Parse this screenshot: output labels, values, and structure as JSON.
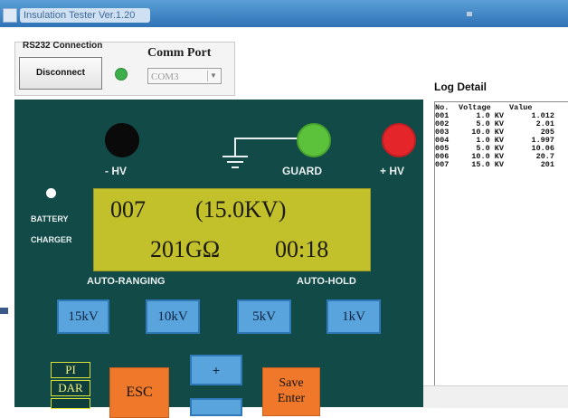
{
  "window": {
    "title": "Insulation Tester Ver.1.20"
  },
  "connection": {
    "group_label": "RS232 Connection",
    "disconnect_label": "Disconnect",
    "comm_port_label": "Comm Port",
    "comm_port_value": "COM3",
    "status_color": "#3cae4a"
  },
  "panel": {
    "hv_minus_label": "- HV",
    "guard_label": "GUARD",
    "hv_plus_label": "+ HV",
    "battery_label": "BATTERY",
    "charger_label": "CHARGER",
    "display": {
      "record_no": "007",
      "voltage": "(15.0KV)",
      "resistance": "201GΩ",
      "time": "00:18"
    },
    "auto_ranging_label": "AUTO-RANGING",
    "auto_hold_label": "AUTO-HOLD",
    "range_buttons": [
      "15kV",
      "10kV",
      "5kV",
      "1kV"
    ],
    "mode_labels": [
      "PI",
      "DAR"
    ],
    "esc_label": "ESC",
    "plus_label": "+",
    "save_label_line1": "Save",
    "save_label_line2": "Enter",
    "colors": {
      "panel": "#124a48",
      "lcd": "#c3c12b",
      "button_blue": "#5aa4dd",
      "button_orange": "#f0782a"
    }
  },
  "log": {
    "title": "Log Detail",
    "headers": [
      "No.",
      "Voltage",
      "Value"
    ],
    "rows": [
      [
        "001",
        "1.0 KV",
        "1.012"
      ],
      [
        "002",
        "5.0 KV",
        "2.01"
      ],
      [
        "003",
        "10.0 KV",
        "205"
      ],
      [
        "004",
        "1.0 KV",
        "1.997"
      ],
      [
        "005",
        "5.0 KV",
        "10.06"
      ],
      [
        "006",
        "10.0 KV",
        "20.7"
      ],
      [
        "007",
        "15.0 KV",
        "201"
      ]
    ]
  }
}
